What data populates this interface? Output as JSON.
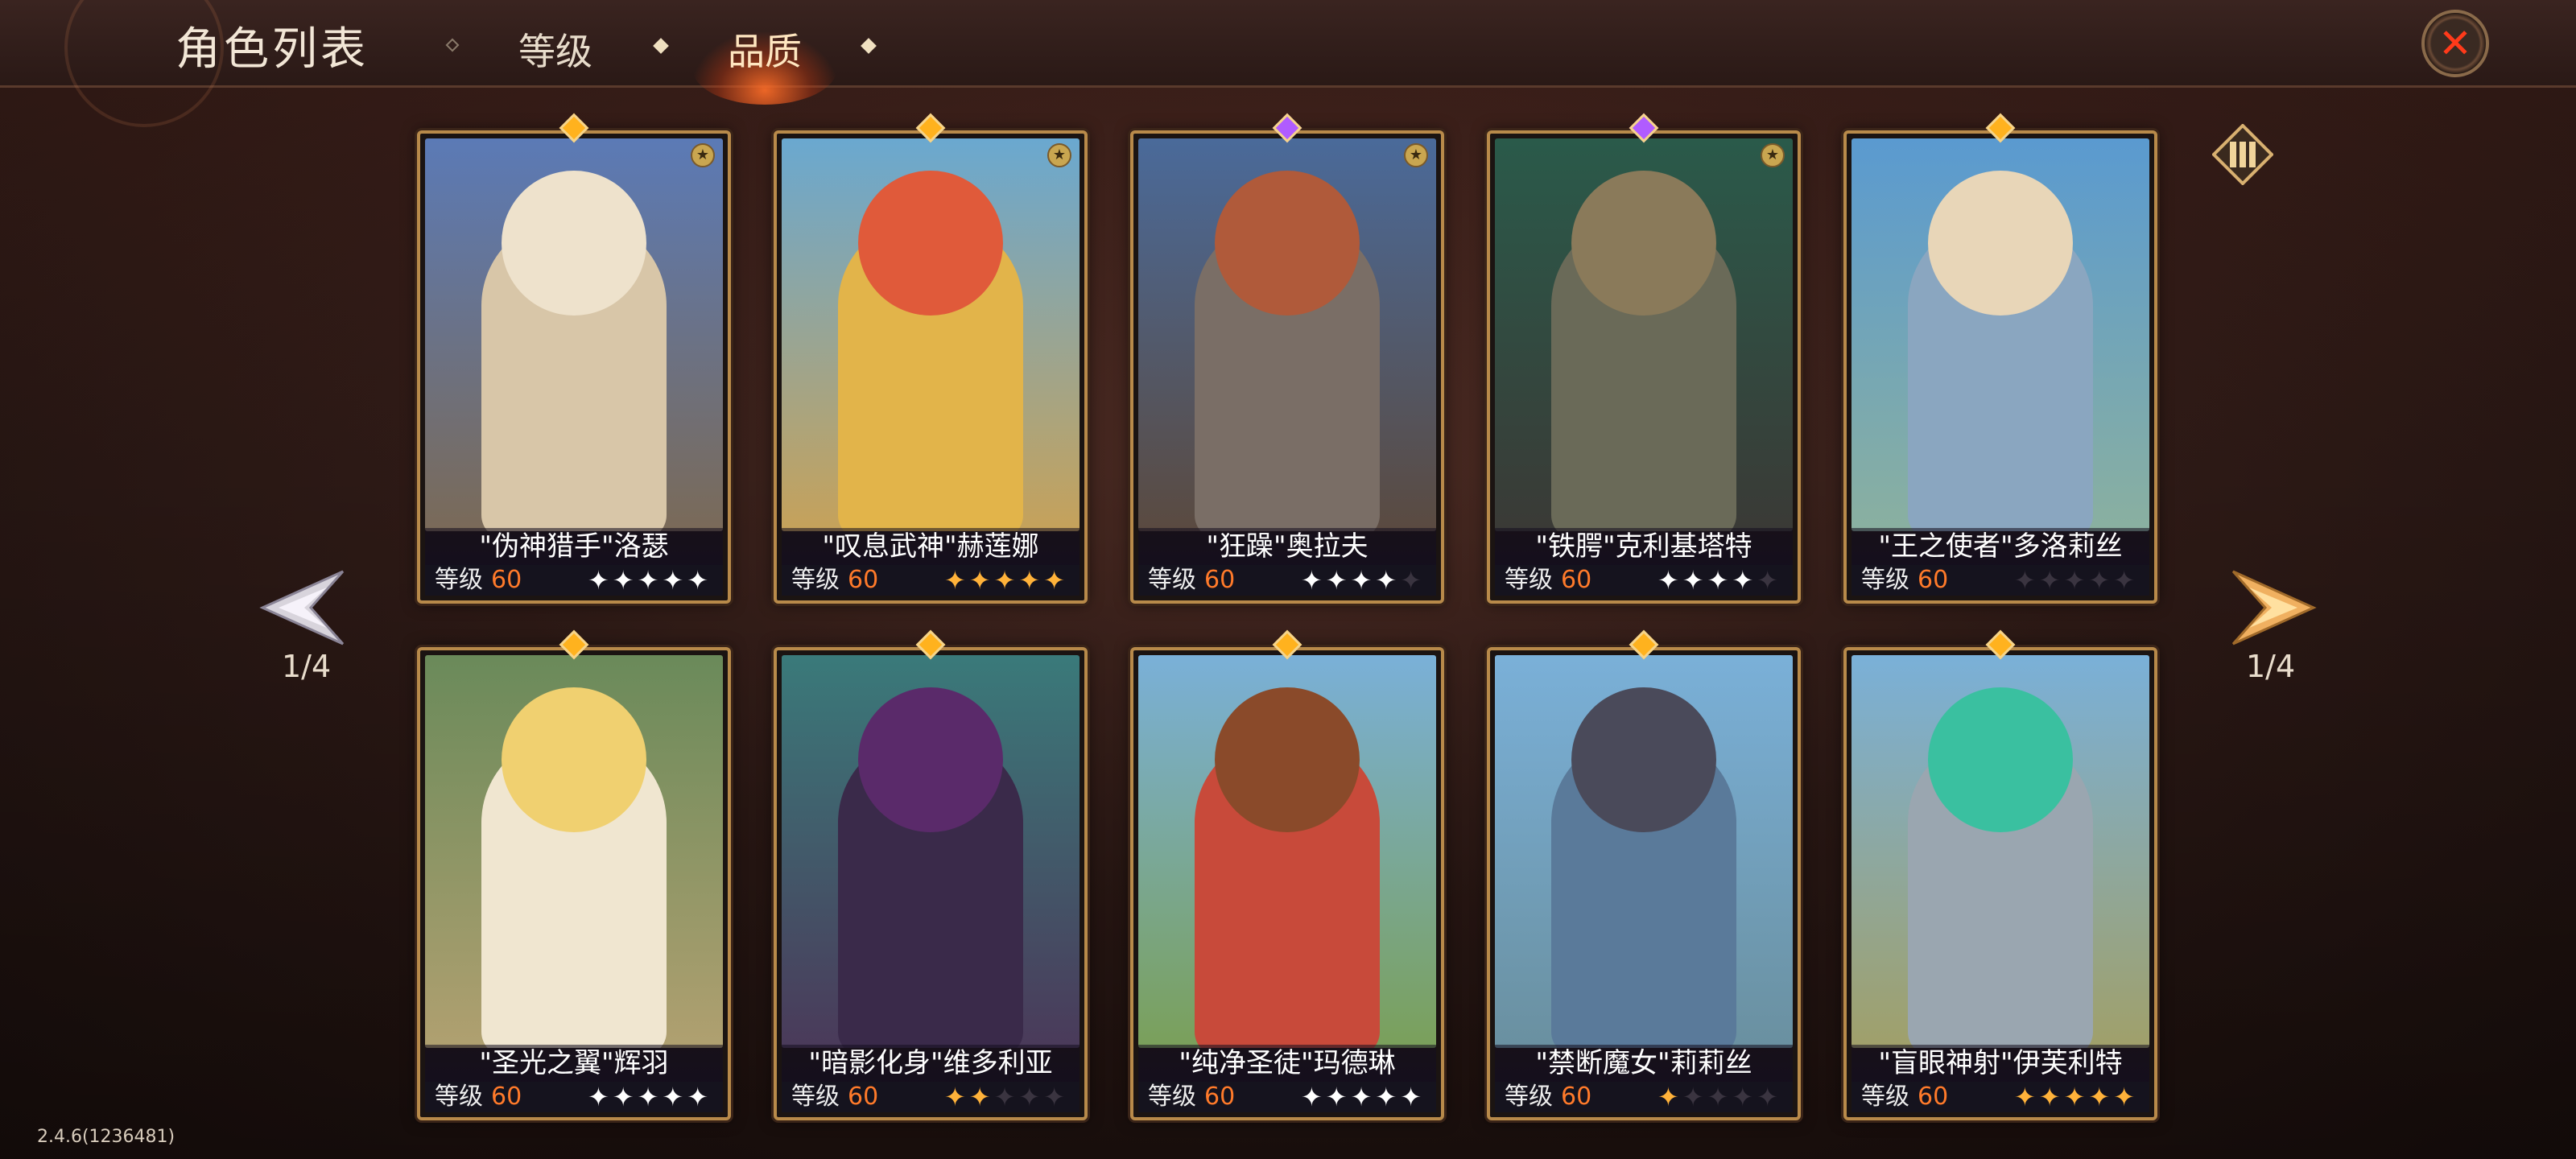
{
  "header": {
    "title": "角色列表",
    "tabs": [
      {
        "label": "等级",
        "active": false
      },
      {
        "label": "品质",
        "active": true
      }
    ]
  },
  "pager": {
    "left": "1/4",
    "right": "1/4"
  },
  "version": "2.4.6(1236481)",
  "level_label": "等级",
  "icons": {
    "close": "close-icon",
    "list_toggle": "list-view-icon",
    "prev": "arrow-left-icon",
    "next": "arrow-right-icon",
    "badge": "star-badge-icon"
  },
  "cards": [
    {
      "name": "\"伪神猎手\"洛瑟",
      "level": "60",
      "stars_on": 5,
      "star_color": "white",
      "gem": "gold",
      "badge": true,
      "colors": {
        "bg_top": "#5b7ab6",
        "bg_bottom": "#7a6a58",
        "figure": "#d8c6a8",
        "head": "#eee2cc"
      }
    },
    {
      "name": "\"叹息武神\"赫莲娜",
      "level": "60",
      "stars_on": 5,
      "star_color": "gold",
      "gem": "gold",
      "badge": true,
      "colors": {
        "bg_top": "#6aa8d0",
        "bg_bottom": "#c6a25a",
        "figure": "#e2b44a",
        "head": "#e05a3a"
      }
    },
    {
      "name": "\"狂躁\"奥拉夫",
      "level": "60",
      "stars_on": 4,
      "star_color": "white",
      "gem": "purple",
      "badge": true,
      "colors": {
        "bg_top": "#4a6a9a",
        "bg_bottom": "#5a4a40",
        "figure": "#7a6e66",
        "head": "#b05a3a"
      }
    },
    {
      "name": "\"铁腭\"克利基塔特",
      "level": "60",
      "stars_on": 4,
      "star_color": "white",
      "gem": "purple",
      "badge": true,
      "colors": {
        "bg_top": "#2a5a4a",
        "bg_bottom": "#3a3a36",
        "figure": "#6a6a58",
        "head": "#8a7a5a"
      }
    },
    {
      "name": "\"王之使者\"多洛莉丝",
      "level": "60",
      "stars_on": 0,
      "star_color": "white",
      "gem": "gold",
      "badge": false,
      "colors": {
        "bg_top": "#5a9ad0",
        "bg_bottom": "#8ab0a0",
        "figure": "#8aa6c0",
        "head": "#e8d6b8"
      }
    },
    {
      "name": "\"圣光之翼\"辉羽",
      "level": "60",
      "stars_on": 5,
      "star_color": "white",
      "gem": "gold",
      "badge": false,
      "colors": {
        "bg_top": "#6a8a5a",
        "bg_bottom": "#b0a070",
        "figure": "#f0e6d0",
        "head": "#f0d070"
      }
    },
    {
      "name": "\"暗影化身\"维多利亚",
      "level": "60",
      "stars_on": 2,
      "star_color": "gold",
      "gem": "gold",
      "badge": false,
      "colors": {
        "bg_top": "#3a7a7a",
        "bg_bottom": "#4a3a5a",
        "figure": "#3a2a4a",
        "head": "#5a2a6a"
      }
    },
    {
      "name": "\"纯净圣徒\"玛德琳",
      "level": "60",
      "stars_on": 5,
      "star_color": "white",
      "gem": "gold",
      "badge": false,
      "colors": {
        "bg_top": "#7ab0d8",
        "bg_bottom": "#7aa05a",
        "figure": "#c84a3a",
        "head": "#8a4a2a"
      }
    },
    {
      "name": "\"禁断魔女\"莉莉丝",
      "level": "60",
      "stars_on": 1,
      "star_color": "gold",
      "gem": "gold",
      "badge": false,
      "colors": {
        "bg_top": "#7ab0d8",
        "bg_bottom": "#6a90a0",
        "figure": "#5a7a9a",
        "head": "#4a4a5a"
      }
    },
    {
      "name": "\"盲眼神射\"伊芙利特",
      "level": "60",
      "stars_on": 5,
      "star_color": "gold",
      "gem": "gold",
      "badge": false,
      "colors": {
        "bg_top": "#7ab0d8",
        "bg_bottom": "#a0a06a",
        "figure": "#9aa6b0",
        "head": "#3ac0a0"
      }
    }
  ]
}
